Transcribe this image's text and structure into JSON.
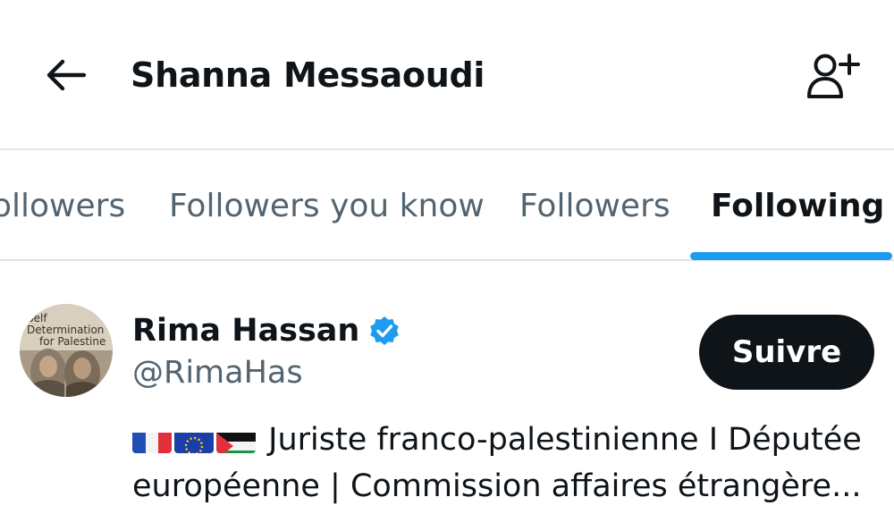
{
  "header": {
    "title": "Shanna Messaoudi",
    "back_icon": "arrow-left-icon",
    "add_icon": "person-add-icon"
  },
  "tabs": [
    {
      "label": "ollowers",
      "active": false
    },
    {
      "label": "Followers you know",
      "active": false
    },
    {
      "label": "Followers",
      "active": false
    },
    {
      "label": "Following",
      "active": true
    }
  ],
  "users": [
    {
      "name": "Rima Hassan",
      "handle": "@RimaHas",
      "verified": true,
      "follow_label": "Suivre",
      "avatar_text": [
        "Self",
        "Determination",
        "for Palestine"
      ],
      "bio_flags": [
        "flag-france",
        "flag-eu",
        "flag-palestine"
      ],
      "bio_line1": " Juriste franco-palestinienne I Députée",
      "bio_line2": "européenne | Commission affaires étrangère..."
    }
  ],
  "colors": {
    "accent": "#1d9bf0",
    "text_primary": "#0f1419",
    "text_secondary": "#536471",
    "divider": "#e4e8eb",
    "button_bg": "#0f1419"
  }
}
